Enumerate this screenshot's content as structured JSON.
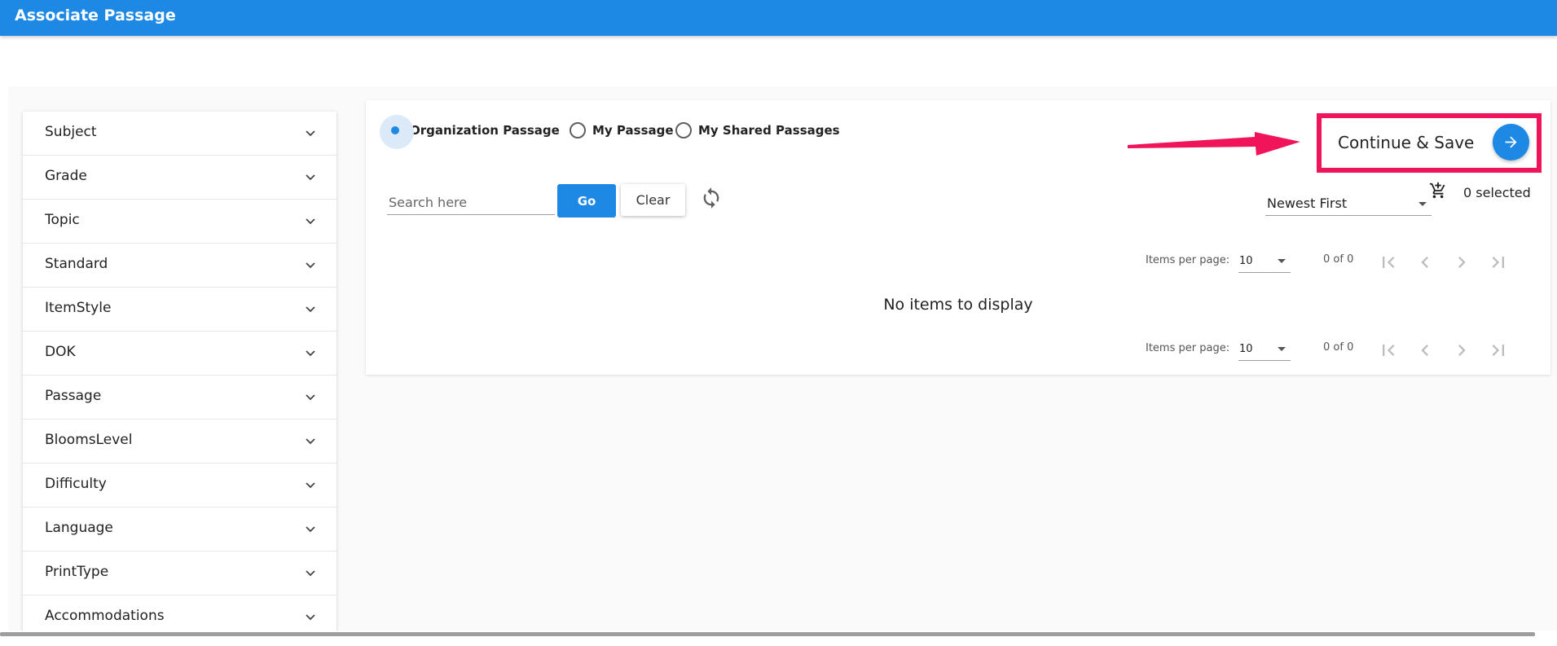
{
  "app": {
    "title": "Associate Passage"
  },
  "sidebar": {
    "items": [
      {
        "label": "Subject"
      },
      {
        "label": "Grade"
      },
      {
        "label": "Topic"
      },
      {
        "label": "Standard"
      },
      {
        "label": "ItemStyle"
      },
      {
        "label": "DOK"
      },
      {
        "label": "Passage"
      },
      {
        "label": "BloomsLevel"
      },
      {
        "label": "Difficulty"
      },
      {
        "label": "Language"
      },
      {
        "label": "PrintType"
      },
      {
        "label": "Accommodations"
      }
    ]
  },
  "passage_type": {
    "options": [
      {
        "label": "Organization Passage",
        "checked": true
      },
      {
        "label": "My Passage",
        "checked": false
      },
      {
        "label": "My Shared Passages",
        "checked": false
      }
    ]
  },
  "search": {
    "placeholder": "Search here",
    "value": "",
    "go_label": "Go",
    "clear_label": "Clear"
  },
  "sort": {
    "value": "Newest First"
  },
  "selection": {
    "count_label": "0 selected"
  },
  "paginator_top": {
    "label": "Items per page:",
    "page_size": "10",
    "range": "0 of 0"
  },
  "paginator_bottom": {
    "label": "Items per page:",
    "page_size": "10",
    "range": "0 of 0"
  },
  "empty_message": "No items to display",
  "actions": {
    "continue_save_label": "Continue & Save"
  },
  "colors": {
    "primary": "#1e88e5",
    "highlight": "#f0145a",
    "annotation_arrow": "#f0145a"
  },
  "icons": [
    "chevron-down-icon",
    "refresh-icon",
    "cart-plus-icon",
    "first-page-icon",
    "prev-page-icon",
    "next-page-icon",
    "last-page-icon",
    "arrow-right-icon"
  ]
}
